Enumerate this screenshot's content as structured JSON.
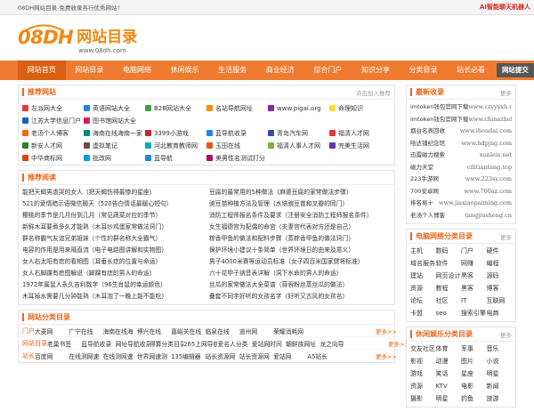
{
  "topbar": {
    "left_text": "08DH网站目录-免费收录各行优秀网站！",
    "right_text": "AI智能聊天机器人"
  },
  "logo": {
    "word": "08DH",
    "title": "网站目录",
    "url": "www.08dh.com"
  },
  "nav": {
    "items": [
      "网站首页",
      "网站目录",
      "电脑网络",
      "休闲娱乐",
      "生活服务",
      "商业经济",
      "综合门户",
      "知识分享",
      "分类目录",
      "站长必看"
    ],
    "submit_label": "网站提交"
  },
  "recommended_sites": {
    "title": "推荐网站",
    "more": "点击加入推荐",
    "items": [
      {
        "name": "左派网大全",
        "icon": "#e53935"
      },
      {
        "name": "英语网站大全",
        "icon": "#1e88e5"
      },
      {
        "name": "B2B网站大全",
        "icon": "#43a047"
      },
      {
        "name": "名站导航网址",
        "icon": "#fb8c00"
      },
      {
        "name": "www.pigai.org",
        "icon": "#8e24aa"
      },
      {
        "name": "命理知识",
        "icon": "#fdd835"
      },
      {
        "name": "江苏大学信息门户",
        "icon": "#1565c0"
      },
      {
        "name": "图书馆网站大全",
        "icon": "#d81b60"
      },
      {
        "name": "",
        "icon": ""
      },
      {
        "name": "",
        "icon": ""
      },
      {
        "name": "",
        "icon": ""
      },
      {
        "name": "",
        "icon": ""
      },
      {
        "name": "老汤个人博客",
        "icon": "#ef6c00"
      },
      {
        "name": "海南在线海南一家",
        "icon": "#00897b"
      },
      {
        "name": "3399小游戏",
        "icon": "#c62828"
      },
      {
        "name": "蓝导航收录",
        "icon": "#1e88e5"
      },
      {
        "name": "青岛汽车网",
        "icon": "#3949ab"
      },
      {
        "name": "福清人才网",
        "icon": "#e53935"
      },
      {
        "name": "新安人才网",
        "icon": "#2e7d32"
      },
      {
        "name": "虚拟笔记",
        "icon": "#6d4c41"
      },
      {
        "name": "河北教育教师网",
        "icon": "#00acc1"
      },
      {
        "name": "玉田在线",
        "icon": "#f4511e"
      },
      {
        "name": "福清人事人才网",
        "icon": "#7cb342"
      },
      {
        "name": "完美生活网",
        "icon": "#5e35b1"
      },
      {
        "name": "中华商标网",
        "icon": "#d84315"
      },
      {
        "name": "批改网",
        "icon": "#039be5"
      },
      {
        "name": "蓝导航",
        "icon": "#1e88e5"
      },
      {
        "name": "美男性名测试打分",
        "icon": "#ad1457"
      },
      {
        "name": "",
        "icon": ""
      },
      {
        "name": "",
        "icon": ""
      }
    ]
  },
  "recommended_reading": {
    "title": "推荐阅读",
    "items": [
      "能把天蝎男虐哭的女人（把天蝎伤得最惨的星座）",
      "豆腐的最常用的5种做法（麻婆豆腐的家常做法步骤）",
      "521的爱情暗示语微信聊天（520告白情话最暖心短句）",
      "豌豆苗种植方法及管理（水培豌豆苗和叉瓣的同门）",
      "樱桃的季节是几月份到几月（常见蔬菜对应的季节）",
      "消防工程师报名条件及要求（注册安全消防工程师报名条件）",
      "新鲜木耳要煮多久才能熟（木耳炒鸡蛋家常做法窍门）",
      "女生福德宫为配偶的命宫（夫妻宫代表对方还是自己）",
      "群名称霸气友谊兄弟姐妹（个性的群名称大全霸气）",
      "粽香甲鱼的做法和配料步骤（蒸粽香甲鱼的做法窍门）",
      "电容的作用是用来隔直流（电子电路图讲解和实物图）",
      "保护环境小建议十条简单（世界环境日的由来及意义）",
      "女人右太阳有痣的看相图（耳垂长痣的位置与命运）",
      "男子4000米赛等运动员标准（女子四百米国家健将标准）",
      "女人右脚踝有痣图解说（脚踝有痣的男人的命运）",
      "六十花甲子纳音表详解（洞下水命的男人的命运）",
      "1972年属鼠人永久吉利数字（96生肖鼠的幸运颜色）",
      "丝瓜的家常做法大全菜谱（蒜蓉粉丝蒸丝瓜的做法）",
      "木耳掉水需要几分钟能熟（木耳泡了一晚上能不能吃）",
      "叠套不同字好听的女孩名字（好听又古风的女孩名）"
    ]
  },
  "category_dir": {
    "title": "网站分类目录",
    "rows": [
      {
        "label": "门户",
        "links": [
          "大麦网",
          "广宁在线",
          "海南在线海",
          "博兴在线",
          "嘉峪关在线",
          "临泉在线",
          "道州网",
          "荣耀消耗网",
          "",
          ""
        ],
        "more": "更多>>"
      },
      {
        "label": "网站目录",
        "links": [
          "老巢书签",
          "蓝导航收录",
          "网址导航收录",
          "得算分类目录",
          "265上网导航",
          "爱名人分类",
          "爱站网时间",
          "朝鲜族网址",
          "龙之向导",
          ""
        ],
        "more": "更多>>"
      },
      {
        "label": "站长",
        "links": [
          "百度网",
          "在线测网速",
          "在线测网速",
          "世界网速测",
          "135编辑器",
          "站长资源网",
          "站长资源网",
          "爱站网",
          "A5站长",
          ""
        ],
        "more": "更多>>"
      }
    ]
  },
  "newest": {
    "title": "最新收录",
    "more": "更多",
    "items": [
      {
        "name": "imtoken钱包官网下载",
        "url": "www.czyyyxh.com"
      },
      {
        "name": "imtoken钱包官网下载",
        "url": "www.chinazhehen.com"
      },
      {
        "name": "烟台名表回收",
        "url": "www.ihoudai.com"
      },
      {
        "name": "哈达铺纪念馆",
        "url": "www.hdpjng.com"
      },
      {
        "name": "迅雷磁力搜索",
        "url": "xunleis.net"
      },
      {
        "name": "磁力天堂",
        "url": "cilitiantang.top"
      },
      {
        "name": "223手游网",
        "url": "www.223sy.com"
      },
      {
        "name": "700安卓网",
        "url": "www.700az.com"
      },
      {
        "name": "排名易十",
        "url": "www.jiaxiaopaiming.com"
      },
      {
        "name": "老汤个人博客",
        "url": "tangjiusheng.cn"
      }
    ]
  },
  "computer_dir": {
    "title": "电脑网络分类目录",
    "more": "更多",
    "items": [
      "主机",
      "数码",
      "门户",
      "硬件",
      "域名服务",
      "软件",
      "网赚",
      "编程",
      "建站",
      "网页设计",
      "黑客",
      "源码",
      "资源",
      "教程",
      "黑客",
      "博客",
      "论坛",
      "社区",
      "IT",
      "互联网",
      "卡盟",
      "seo",
      "搜索引擎",
      "电商"
    ]
  },
  "leisure_dir": {
    "title": "休闲娱乐分类目录",
    "more": "更多",
    "items": [
      "交友社区",
      "体育",
      "军事",
      "音乐",
      "影视",
      "动漫",
      "图片",
      "小说",
      "游戏",
      "笑话",
      "星座",
      "明星",
      "资源",
      "KTV",
      "电影",
      "新闻",
      "摄影",
      "明星",
      "钓鱼",
      "旅游"
    ]
  }
}
